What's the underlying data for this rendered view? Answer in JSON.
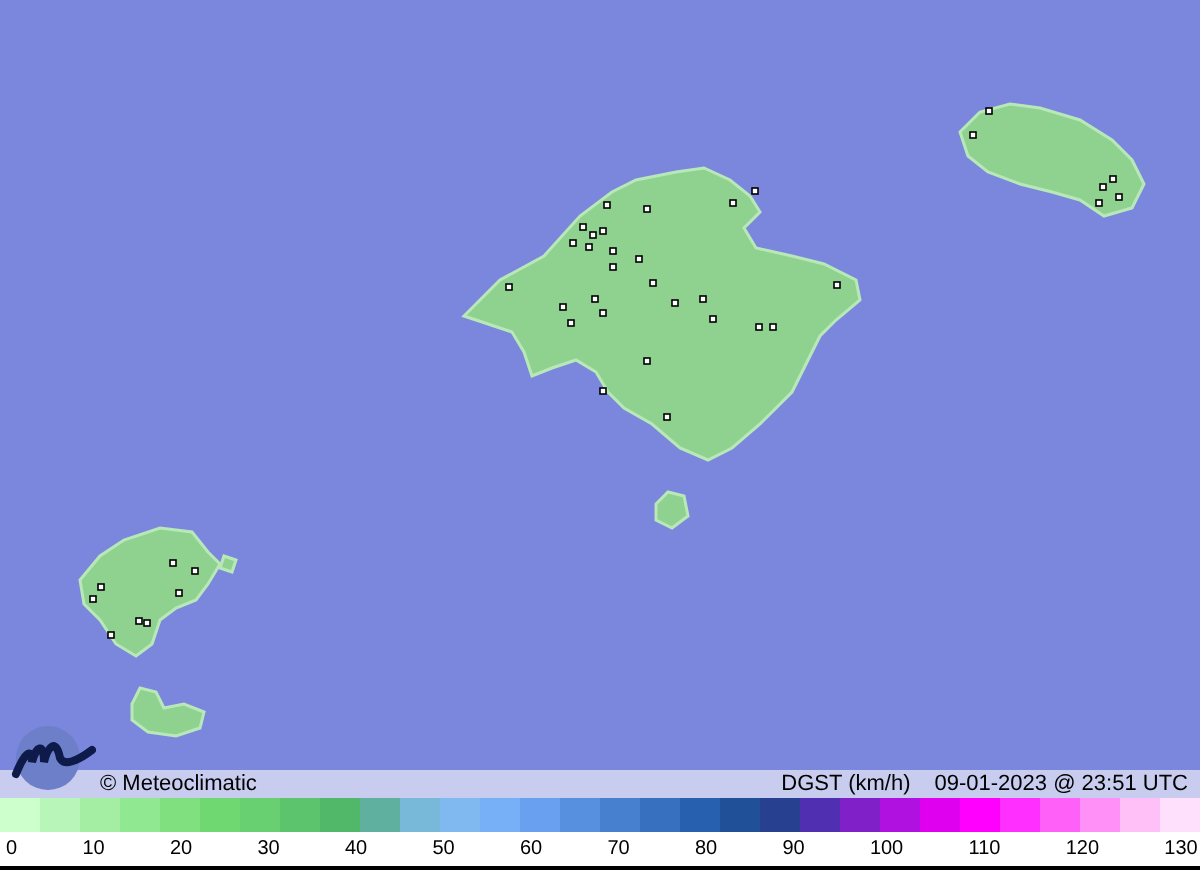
{
  "caption": {
    "credit": "© Meteoclimatic",
    "variable": "DGST (km/h)",
    "timestamp": "09-01-2023 @ 23:51 UTC"
  },
  "scale": {
    "swatches": [
      {
        "color": "#ccffcc"
      },
      {
        "color": "#b8f5b8"
      },
      {
        "color": "#a4eea4"
      },
      {
        "color": "#90e890"
      },
      {
        "color": "#80e080"
      },
      {
        "color": "#70d870"
      },
      {
        "color": "#68d070"
      },
      {
        "color": "#5cc46c"
      },
      {
        "color": "#50b868"
      },
      {
        "color": "#60b0a0"
      },
      {
        "color": "#78b8d8"
      },
      {
        "color": "#80b8f0"
      },
      {
        "color": "#78b0f8"
      },
      {
        "color": "#6aa0f0"
      },
      {
        "color": "#5890e0"
      },
      {
        "color": "#4880d0"
      },
      {
        "color": "#3870c0"
      },
      {
        "color": "#2860b0"
      },
      {
        "color": "#205098"
      },
      {
        "color": "#284090"
      },
      {
        "color": "#5030b0"
      },
      {
        "color": "#8020c8"
      },
      {
        "color": "#b010e0"
      },
      {
        "color": "#e000f0"
      },
      {
        "color": "#ff00ff"
      },
      {
        "color": "#ff30ff"
      },
      {
        "color": "#ff60f8"
      },
      {
        "color": "#ff90f8"
      },
      {
        "color": "#ffc0f8"
      },
      {
        "color": "#ffe0fc"
      }
    ],
    "ticks": [
      "0",
      "10",
      "20",
      "30",
      "40",
      "50",
      "60",
      "70",
      "80",
      "90",
      "100",
      "110",
      "120",
      "130"
    ]
  }
}
